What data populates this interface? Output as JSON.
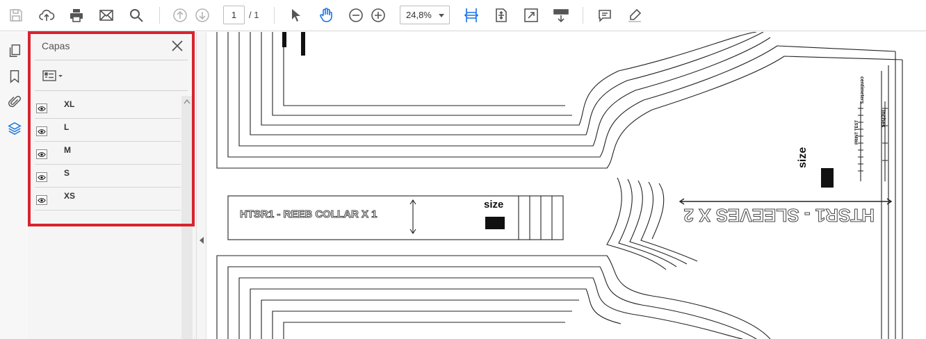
{
  "toolbar": {
    "page_current": "1",
    "page_total": "/ 1",
    "zoom": "24,8%"
  },
  "layers_panel": {
    "title": "Capas",
    "layers": [
      {
        "name": "XL"
      },
      {
        "name": "L"
      },
      {
        "name": "M"
      },
      {
        "name": "S"
      },
      {
        "name": "XS"
      }
    ]
  },
  "document": {
    "collar_label": "HTSR1  - REEB COLLAR X 1",
    "collar_size_label": "size",
    "sleeves_label": "HTSR1 - SLEEVES X 2",
    "sleeves_size_label": "size",
    "inches_label": "inches",
    "centimeters_label": "centimeters",
    "print_test_label": "PRINT TEST"
  },
  "colors": {
    "accent": "#1473e6",
    "highlight": "#d7242f"
  }
}
